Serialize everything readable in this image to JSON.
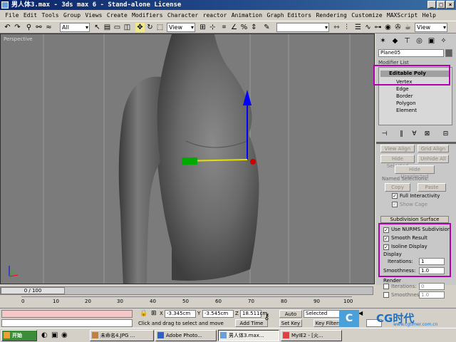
{
  "window": {
    "title": "男人体3.max - 3ds max 6 - Stand-alone License"
  },
  "menu": [
    "File",
    "Edit",
    "Tools",
    "Group",
    "Views",
    "Create",
    "Modifiers",
    "Character",
    "reactor",
    "Animation",
    "Graph Editors",
    "Rendering",
    "Customize",
    "MAXScript",
    "Help"
  ],
  "toolbar": {
    "selection_filter": "All",
    "ref_coord": "View",
    "named_selection": "",
    "view_dropdown": "View"
  },
  "viewport": {
    "label": "Perspective"
  },
  "panel": {
    "object_name": "Plane05",
    "modifier_list": "Modifier List",
    "stack_top": "Editable Poly",
    "stack_items": [
      "Vertex",
      "Edge",
      "Border",
      "Polygon",
      "Element"
    ],
    "buttons": {
      "view_align": "View Align",
      "grid_align": "Grid Align",
      "hide_selected": "Hide Selected",
      "unhide_all": "Unhide All",
      "hide_unselected": "Hide Unselected",
      "copy": "Copy",
      "paste": "Paste"
    },
    "named_selections": "Named Selections:",
    "full_interactivity": "Full Interactivity",
    "show_cage": "Show Cage",
    "subdivision_title": "Subdivision Surface",
    "use_nurms": "Use NURMS Subdivision",
    "smooth_result": "Smooth Result",
    "isoline_display": "Isoline Display",
    "display_label": "Display",
    "iterations_label": "Iterations:",
    "iterations_value": "1",
    "smoothness_label": "Smoothness:",
    "smoothness_value": "1.0",
    "render_label": "Render",
    "render_iterations_value": "0",
    "render_smoothness_value": "1.0"
  },
  "timeline": {
    "frame_counter": "0 / 100",
    "ticks": [
      "0",
      "10",
      "20",
      "30",
      "40",
      "50",
      "60",
      "70",
      "80",
      "90",
      "100"
    ]
  },
  "status": {
    "prompt": "Click and drag to select and move",
    "x_value": "-3.345cm",
    "y_value": "-3.545cm",
    "z_value": "18.511cm",
    "add_time_tag": "Add Time Tag",
    "auto_key": "Auto Key",
    "selected": "Selected",
    "set_key": "Set Key",
    "key_filters": "Key Filters...",
    "x_label": "X",
    "y_label": "Y",
    "z_label": "Z"
  },
  "taskbar": {
    "start": "开始",
    "tasks": [
      "未命名4.JPG ...",
      "Adobe Photo...",
      "男人体3.max...",
      "MyIE2 - [火..."
    ]
  },
  "watermark": {
    "site": "www.cgtimer.com.cn",
    "logo": "CG时代"
  },
  "colors": {
    "title_start": "#0a246a",
    "title_end": "#3a6ea5",
    "viewport_bg": "#7b7b7b",
    "highlight": "#b000b0",
    "gizmo_z": "#0000ff",
    "gizmo_x": "#ff0000",
    "gizmo_y": "#00cc00"
  }
}
